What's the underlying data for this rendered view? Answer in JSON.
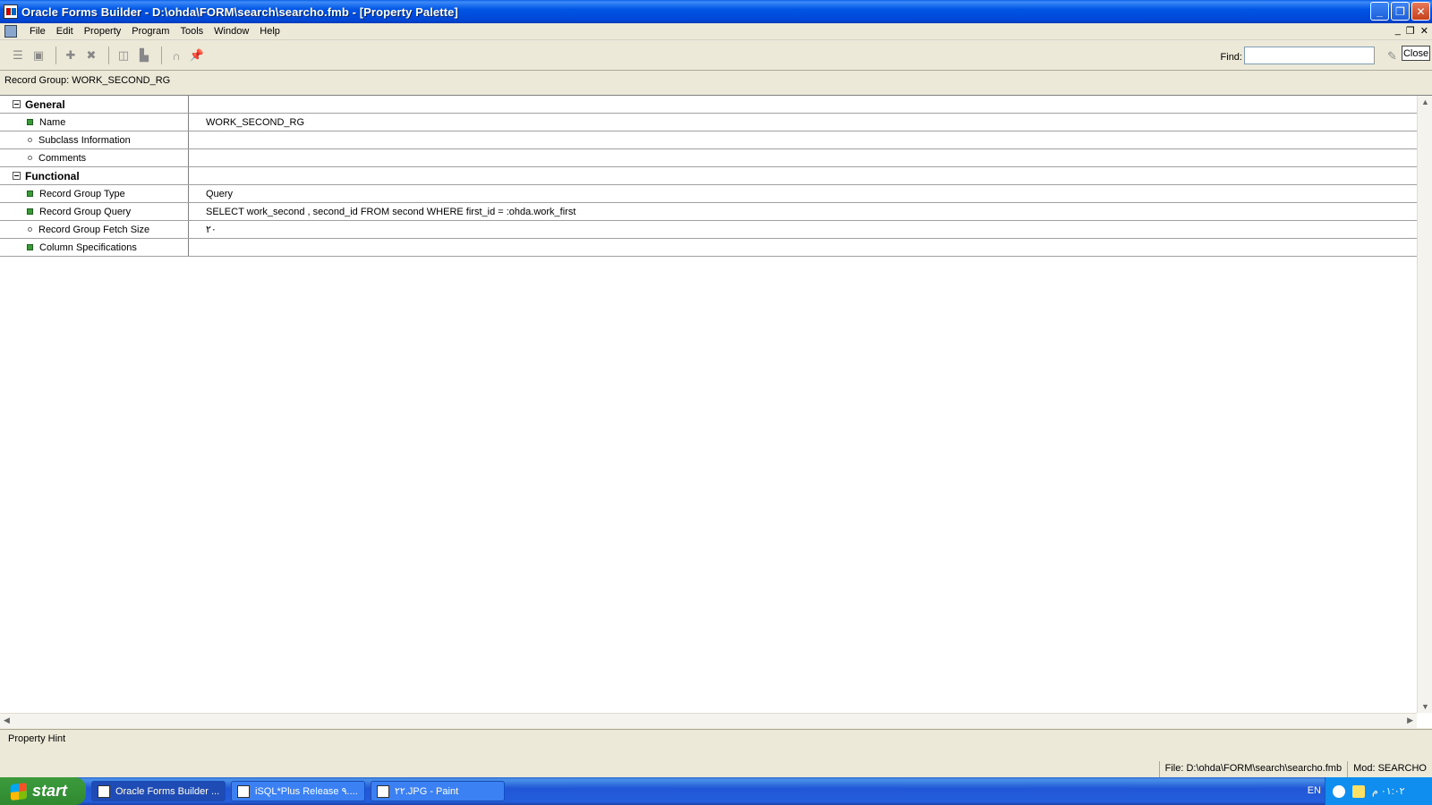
{
  "window": {
    "title": "Oracle Forms Builder - D:\\ohda\\FORM\\search\\searcho.fmb - [Property Palette]",
    "buttons": {
      "minimize": "_",
      "restore": "❐",
      "close": "✕"
    }
  },
  "menu": {
    "items": [
      "File",
      "Edit",
      "Property",
      "Program",
      "Tools",
      "Window",
      "Help"
    ],
    "mdi": {
      "minimize": "_",
      "restore": "❐",
      "close": "✕"
    }
  },
  "toolbar": {
    "find_label": "Find:",
    "find_value": "",
    "close_label": "Close"
  },
  "header": {
    "record_group": "Record Group: WORK_SECOND_RG"
  },
  "properties": [
    {
      "type": "section",
      "name": "General",
      "value": ""
    },
    {
      "type": "item",
      "marker": "square",
      "name": "Name",
      "value": "WORK_SECOND_RG"
    },
    {
      "type": "item",
      "marker": "dot",
      "name": "Subclass Information",
      "value": ""
    },
    {
      "type": "item",
      "marker": "dot",
      "name": "Comments",
      "value": ""
    },
    {
      "type": "section",
      "name": "Functional",
      "value": ""
    },
    {
      "type": "item",
      "marker": "square",
      "name": "Record Group Type",
      "value": "Query"
    },
    {
      "type": "item",
      "marker": "square",
      "name": "Record Group Query",
      "value": "SELECT work_second , second_id  FROM second  WHERE   first_id = :ohda.work_first"
    },
    {
      "type": "item",
      "marker": "dot",
      "name": "Record Group Fetch Size",
      "value": "٢٠"
    },
    {
      "type": "item",
      "marker": "square",
      "name": "Column Specifications",
      "value": ""
    }
  ],
  "hint": {
    "title": "Property Hint"
  },
  "status": {
    "file": "File: D:\\ohda\\FORM\\search\\searcho.fmb",
    "mod": "Mod: SEARCHO"
  },
  "taskbar": {
    "start": "start",
    "tasks": [
      {
        "label": "Oracle Forms Builder ...",
        "active": true
      },
      {
        "label": "iSQL*Plus Release ٩....",
        "active": false
      },
      {
        "label": "٢٢.JPG - Paint",
        "active": false
      }
    ],
    "lang": "EN",
    "clock": "٠١:٠٢ م"
  }
}
